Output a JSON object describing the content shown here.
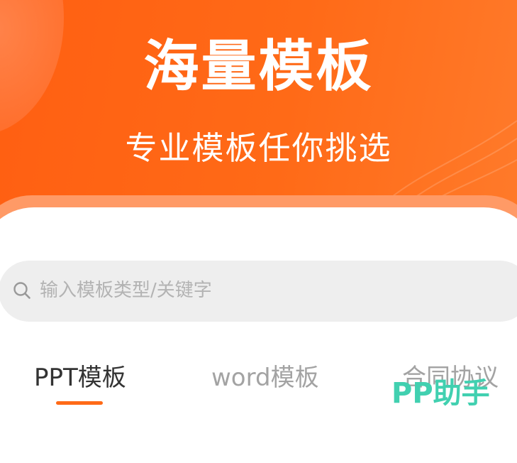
{
  "hero": {
    "title": "海量模板",
    "subtitle": "专业模板任你挑选"
  },
  "search": {
    "placeholder": "输入模板类型/关键字",
    "icon": "search-icon"
  },
  "tabs": [
    {
      "label": "PPT模板",
      "active": true
    },
    {
      "label": "word模板",
      "active": false
    },
    {
      "label": "合同协议",
      "active": false
    }
  ],
  "watermark": {
    "text": "PP助手"
  },
  "colors": {
    "accent": "#ff6a17",
    "hero_bg": "#ff5f12",
    "search_bg": "#eeeeee",
    "active_tab": "#333333",
    "inactive_tab": "#a3a3a3",
    "watermark": "#41d0b0"
  }
}
